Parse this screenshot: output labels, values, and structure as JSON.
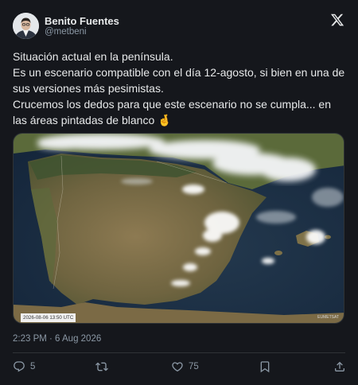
{
  "author": {
    "name": "Benito Fuentes",
    "handle": "@metbeni",
    "avatar_icon": "person-portrait-avatar"
  },
  "header": {
    "logo_icon": "x-logo-icon"
  },
  "tweet": {
    "lines": [
      "Situación actual en la península.",
      "Es un escenario compatible con el día 12-agosto, si bien en una de",
      "sus versiones más pesimistas.",
      "Crucemos los dedos para que este escenario no se cumpla... en",
      "las áreas pintadas de blanco 🤞"
    ],
    "emoji": "🤞"
  },
  "media": {
    "stamp": "2026-08-06 13:50 UTC",
    "credit": "EUMETSAT"
  },
  "timestamp": "2:23 PM · 6 Aug 2026",
  "actions": {
    "reply": {
      "icon": "reply-icon",
      "count": "5"
    },
    "retweet": {
      "icon": "retweet-icon",
      "count": ""
    },
    "like": {
      "icon": "heart-icon",
      "count": "75"
    },
    "bookmark": {
      "icon": "bookmark-icon",
      "count": ""
    },
    "share": {
      "icon": "share-icon",
      "count": ""
    }
  },
  "colors": {
    "background": "#15171c",
    "text": "#e7e9ea",
    "muted": "#8b98a5",
    "border": "#2f3336"
  }
}
